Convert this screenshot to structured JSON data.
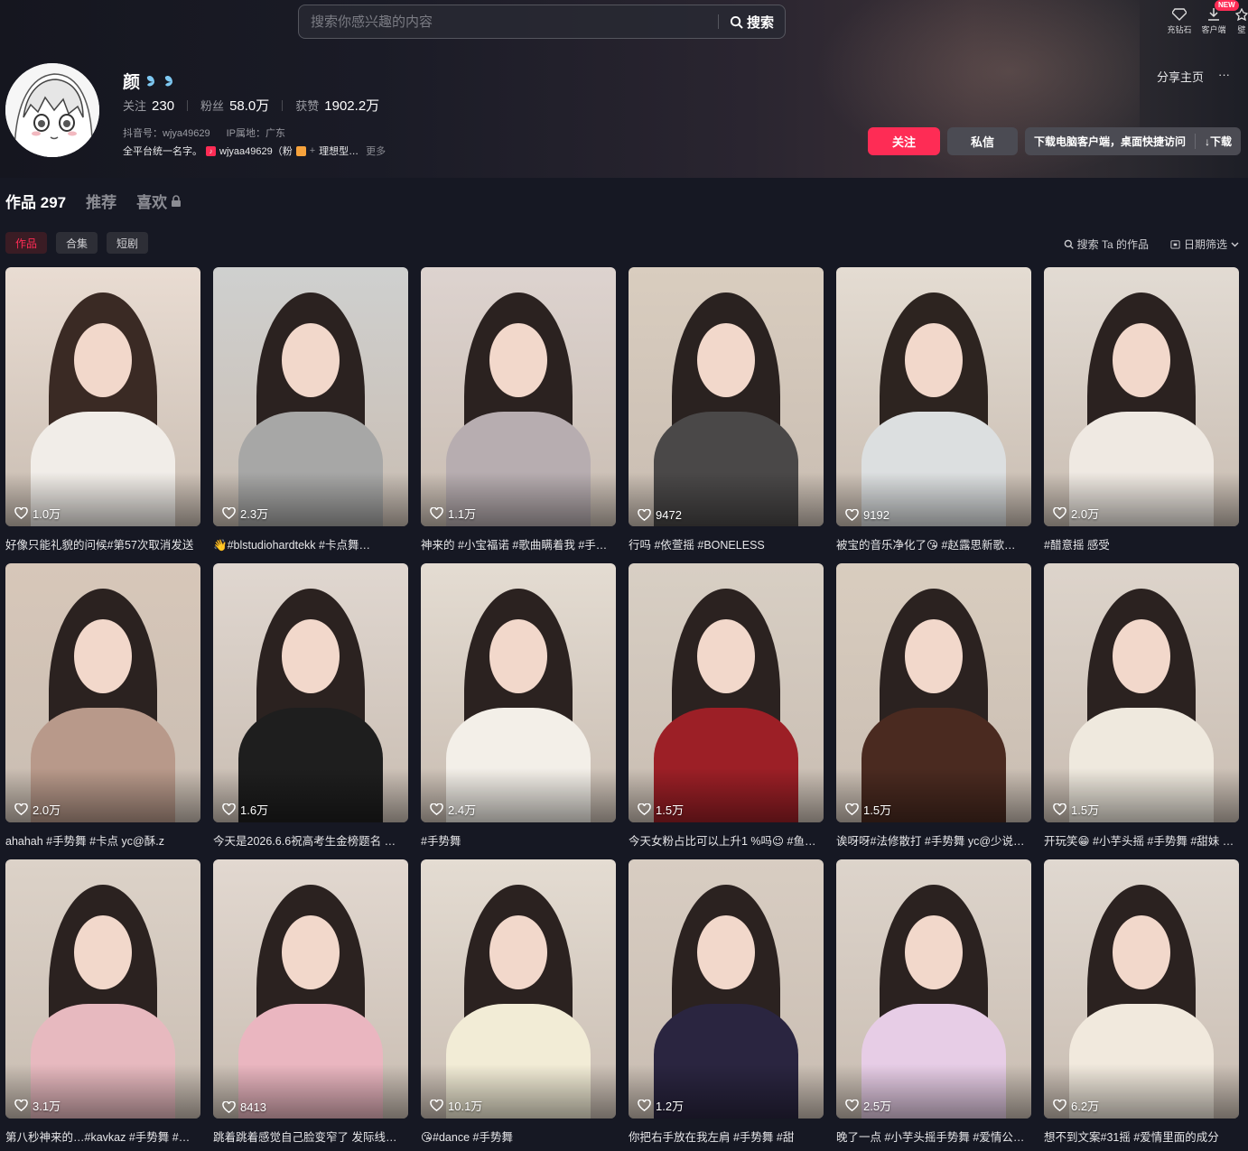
{
  "search": {
    "placeholder": "搜索你感兴趣的内容",
    "button": "搜索"
  },
  "tools": [
    {
      "label": "充钻石",
      "icon": "diamond-icon"
    },
    {
      "label": "客户端",
      "icon": "download-icon",
      "badge": "NEW"
    },
    {
      "label": "壁",
      "icon": "wallpaper-icon"
    }
  ],
  "profile": {
    "name": "颜",
    "following_label": "关注",
    "following": "230",
    "fans_label": "粉丝",
    "fans": "58.0万",
    "likes_label": "获赞",
    "likes": "1902.2万",
    "douyin_id": "抖音号：wjya49629",
    "ip": "IP属地：广东",
    "bio": "全平台统一名字。",
    "bio_account": "wjyaa49629（粉",
    "bio_tail": "理想型…",
    "more": "更多"
  },
  "share": {
    "label": "分享主页",
    "more": "···"
  },
  "actions": {
    "follow": "关注",
    "message": "私信",
    "download_desc": "下载电脑客户端，桌面快捷访问",
    "download": "↓下载"
  },
  "tabs": {
    "works": "作品",
    "works_count": "297",
    "recommend": "推荐",
    "liked": "喜欢"
  },
  "subtabs": [
    "作品",
    "合集",
    "短剧"
  ],
  "filters": {
    "search": "搜索 Ta 的作品",
    "date": "日期筛选"
  },
  "videos": [
    {
      "likes": "1.0万",
      "caption": "好像只能礼貌的问候#第57次取消发送"
    },
    {
      "likes": "2.3万",
      "caption": "👋#blstudiohardtekk #卡点舞…"
    },
    {
      "likes": "1.1万",
      "caption": "神来的 #小宝福诺 #歌曲瞒着我 #手…"
    },
    {
      "likes": "9472",
      "caption": "行吗 #依萱摇 #BONELESS"
    },
    {
      "likes": "9192",
      "caption": "被宝的音乐净化了😘 #赵露思新歌…"
    },
    {
      "likes": "2.0万",
      "caption": "#醋意摇 感受"
    },
    {
      "likes": "2.0万",
      "caption": "ahahah #手势舞 #卡点 yc@酥.z"
    },
    {
      "likes": "1.6万",
      "caption": "今天是2026.6.6祝高考生金榜题名 …"
    },
    {
      "likes": "2.4万",
      "caption": "#手势舞"
    },
    {
      "likes": "1.5万",
      "caption": "今天女粉占比可以上升1 %吗😉 #鱼…"
    },
    {
      "likes": "1.5万",
      "caption": "诶呀呀#法修散打 #手势舞 yc@少说…"
    },
    {
      "likes": "1.5万",
      "caption": "开玩笑😁 #小芋头摇 #手势舞 #甜妹 …"
    },
    {
      "likes": "3.1万",
      "caption": "第八秒神来的…#kavkaz #手势舞 #…"
    },
    {
      "likes": "8413",
      "caption": "跳着跳着感觉自己脸变窄了 发际线…"
    },
    {
      "likes": "10.1万",
      "caption": "😘#dance #手势舞"
    },
    {
      "likes": "1.2万",
      "caption": "你把右手放在我左肩 #手势舞 #甜"
    },
    {
      "likes": "2.5万",
      "caption": "晚了一点 #小芋头摇手势舞 #爱情公…"
    },
    {
      "likes": "6.2万",
      "caption": "想不到文案#31摇 #爱情里面的成分"
    }
  ],
  "colors": {
    "accent": "#fe2c55",
    "background": "#161823"
  }
}
